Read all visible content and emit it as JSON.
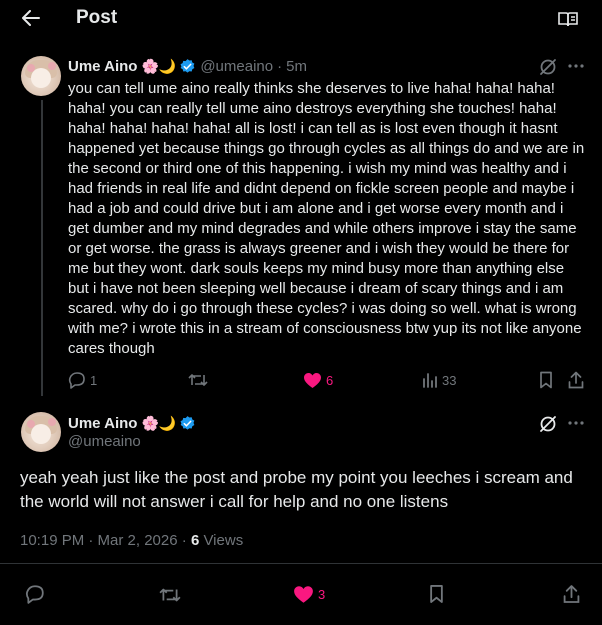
{
  "header": {
    "title": "Post",
    "back_icon": "arrow-left-icon",
    "reader_icon": "book-open-icon"
  },
  "parent_post": {
    "display_name": "Ume Aino",
    "emojis": "🌸🌙",
    "verified": true,
    "handle": "@umeaino",
    "separator": "·",
    "time_ago": "5m",
    "text": "you can tell ume aino really thinks she deserves to live haha! haha! haha! haha! you can really tell ume aino destroys everything she touches! haha! haha! haha! haha! haha! all is lost! i can tell as is lost even though it hasnt happened yet because things go through cycles as all things do and we are in the second or third one of this happening. i wish my mind was healthy and i had friends in real life and didnt depend on fickle screen people and maybe i had a job and could drive but i am alone and i get worse every month and i get dumber and my mind degrades and while others improve i stay the same or get worse. the grass is always greener and i wish they would be there for me but they wont. dark souls keeps my mind busy more than anything else but i have not been sleeping well because i dream of scary things and i am scared. why do i go through these cycles? i was doing so well. what is wrong with me? i wrote this in a stream of consciousness btw yup its not like anyone cares though",
    "stats": {
      "replies": "1",
      "reposts": "",
      "likes": "6",
      "views": "33"
    }
  },
  "main_post": {
    "display_name": "Ume Aino",
    "emojis": "🌸🌙",
    "verified": true,
    "handle": "@umeaino",
    "text": "yeah yeah just like the post and probe my point you leeches i scream and the world will not answer i call for help and no one listens",
    "timestamp": "10:19 PM · Mar 2, 2026",
    "separator": " · ",
    "views_count": "6",
    "views_label": " Views",
    "stats": {
      "replies": "",
      "reposts": "",
      "likes": "3",
      "bookmarks": ""
    }
  },
  "colors": {
    "background": "#000000",
    "text": "#e7e9ea",
    "muted": "#71767b",
    "like": "#f91880",
    "verified": "#1d9bf0",
    "divider": "#2f3336"
  }
}
